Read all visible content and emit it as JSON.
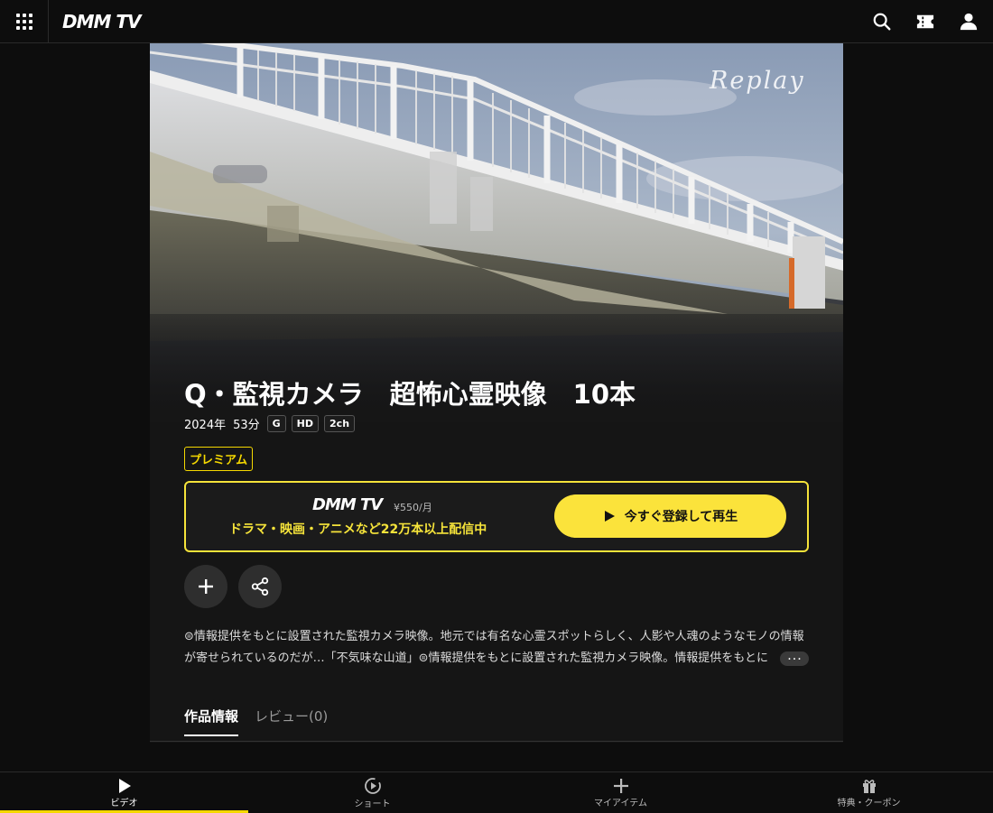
{
  "header": {
    "logo": "DMM TV"
  },
  "hero": {
    "watermark": "Replay"
  },
  "video": {
    "title": "Q・監視カメラ　超怖心霊映像　10本",
    "year": "2024年",
    "duration": "53分",
    "rating": "G",
    "quality": "HD",
    "audio": "2ch",
    "label": "プレミアム"
  },
  "promo": {
    "logo": "DMM TV",
    "price": "¥550/月",
    "subtitle": "ドラマ・映画・アニメなど22万本以上配信中",
    "play_label": "今すぐ登録して再生"
  },
  "description": {
    "text": "⊜情報提供をもとに設置された監視カメラ映像。地元では有名な心霊スポットらしく、人影や人魂のようなモノの情報が寄せられているのだが…「不気味な山道」⊜情報提供をもとに設置された監視カメラ映像。情報提供をもとに",
    "more_label": "･･･"
  },
  "tabs": [
    {
      "label": "作品情報"
    },
    {
      "label": "レビュー(0)"
    }
  ],
  "bottom_nav": [
    {
      "label": "ビデオ"
    },
    {
      "label": "ショート"
    },
    {
      "label": "マイアイテム"
    },
    {
      "label": "特典・クーポン"
    }
  ],
  "colors": {
    "accent": "#f5d800",
    "button": "#fbe33b",
    "background": "#0d0d0d"
  }
}
